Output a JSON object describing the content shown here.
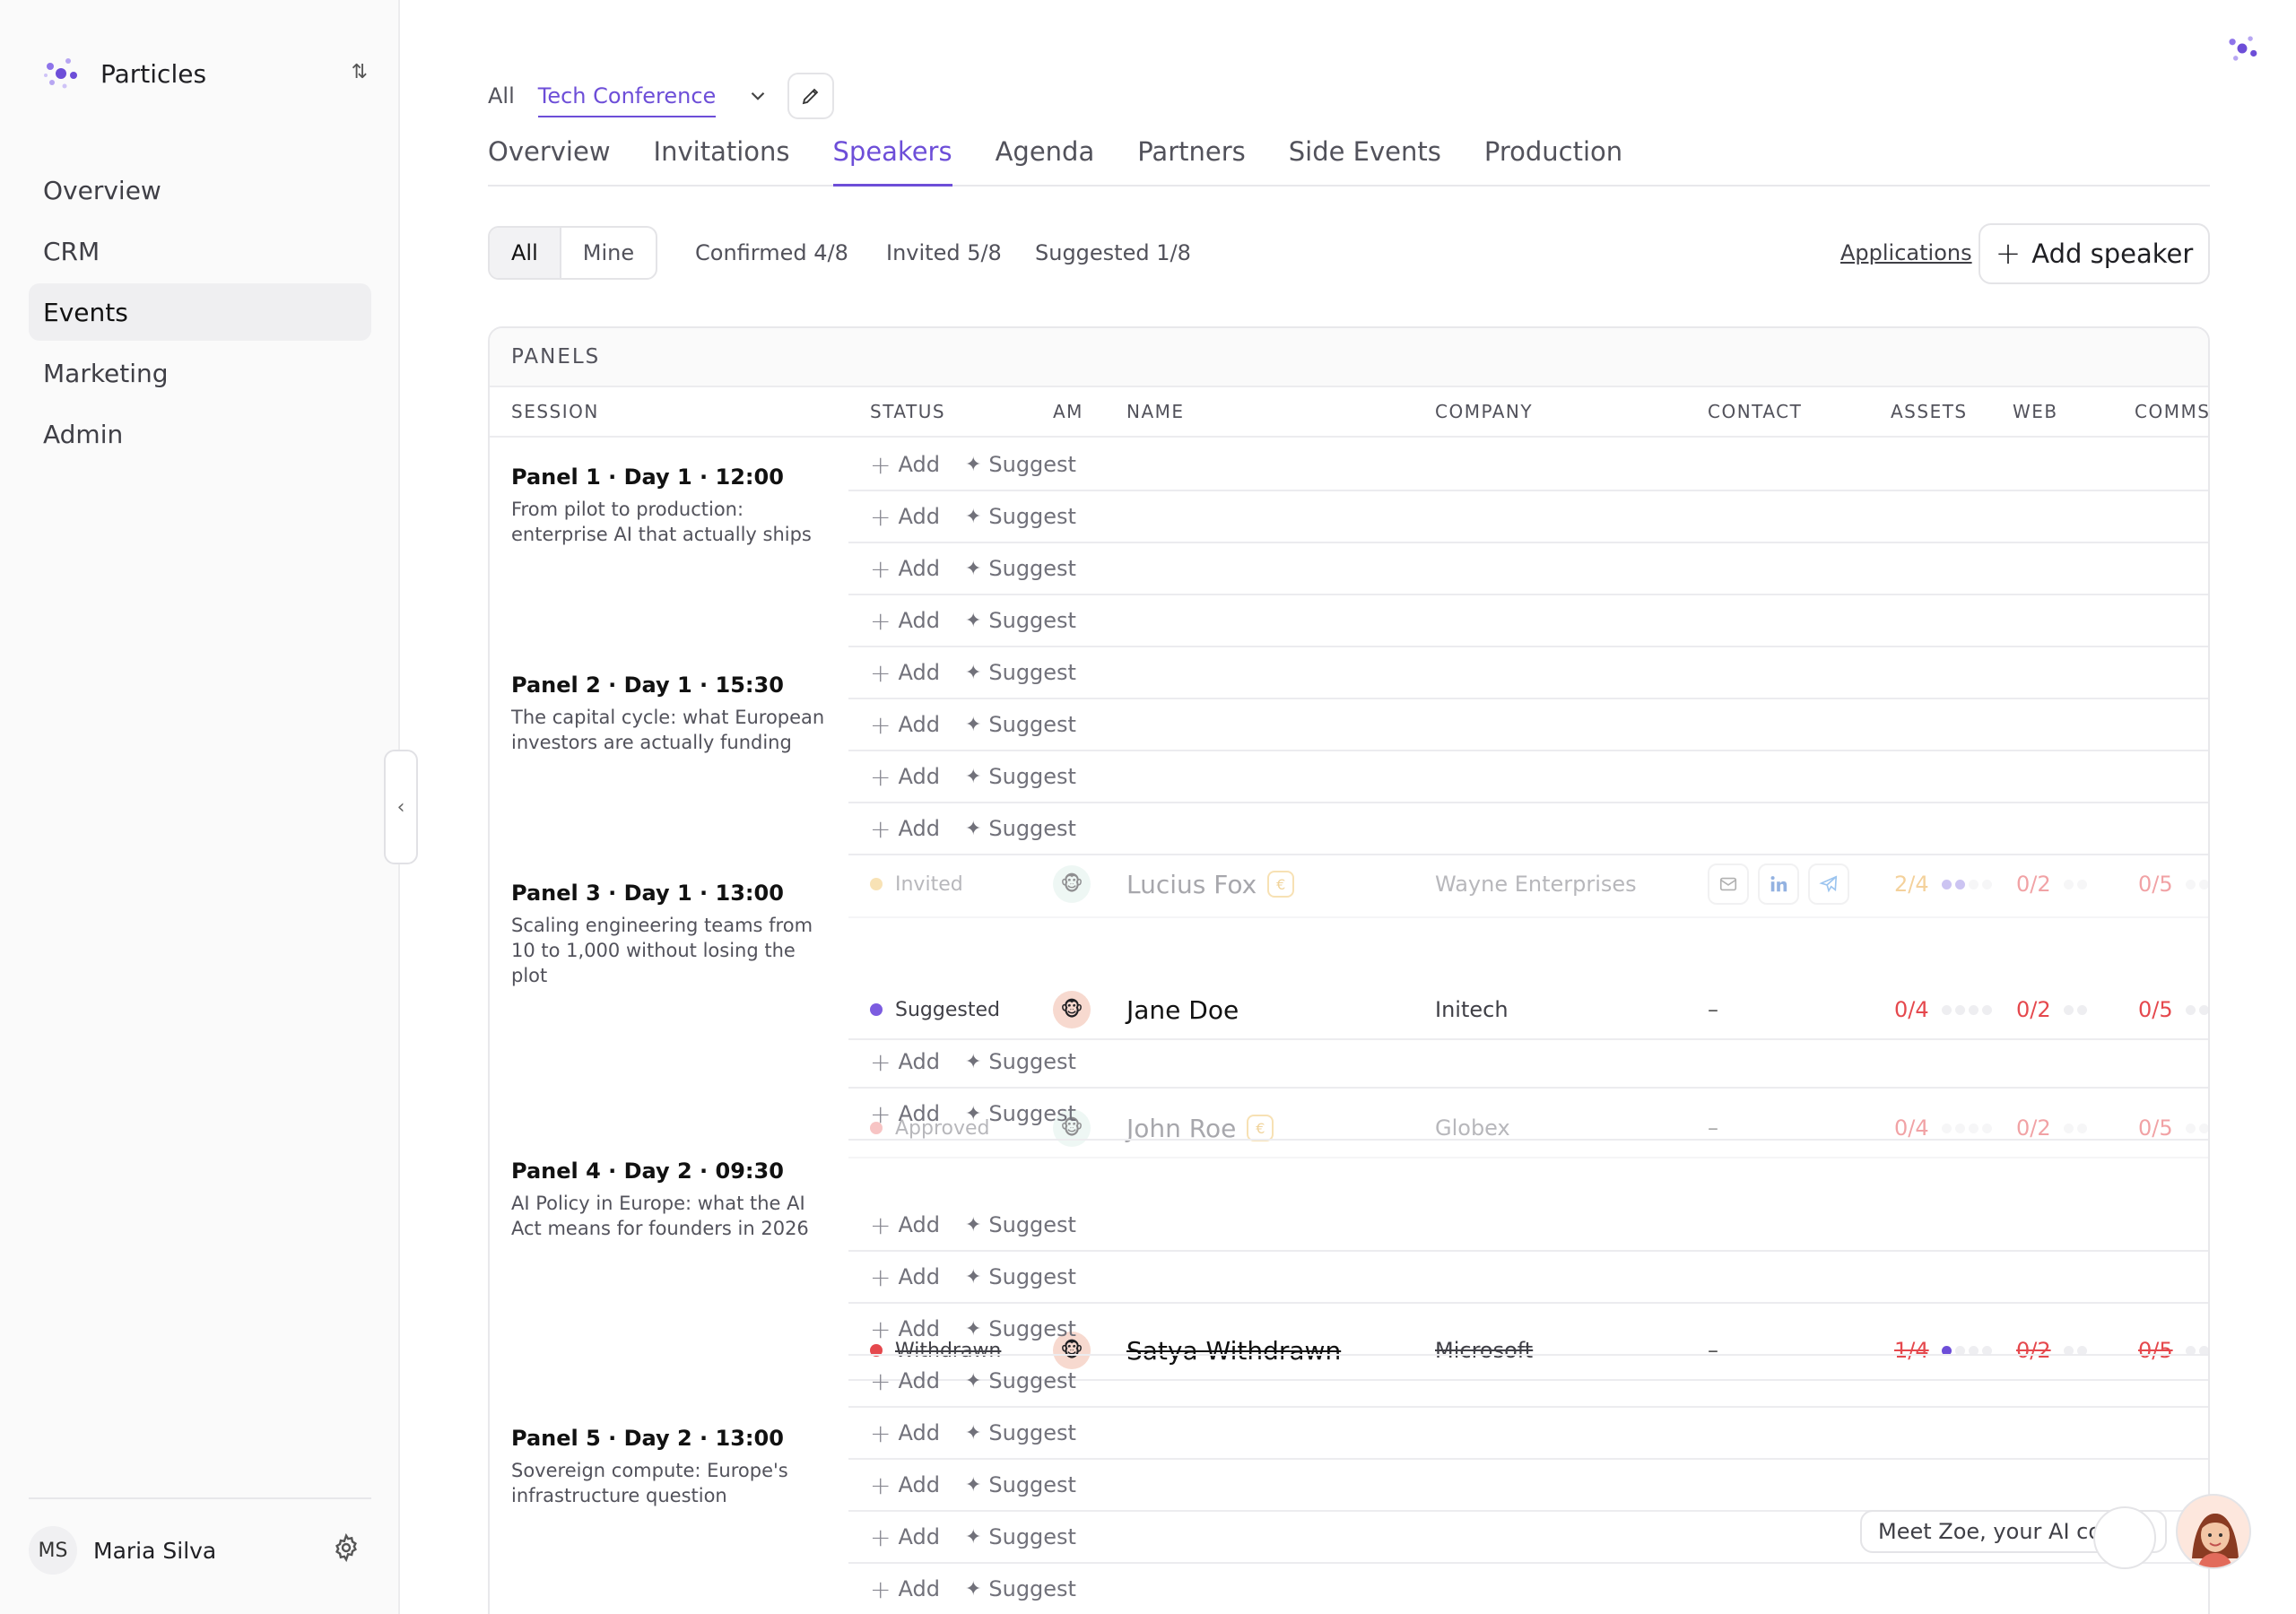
{
  "sidebar": {
    "brand": "Particles",
    "switch_icon": "⇅",
    "items": [
      {
        "label": "Overview"
      },
      {
        "label": "CRM"
      },
      {
        "label": "Events"
      },
      {
        "label": "Marketing"
      },
      {
        "label": "Admin"
      }
    ],
    "user": {
      "initials": "MS",
      "name": "Maria Silva"
    },
    "collapse_glyph": "‹"
  },
  "header": {
    "crumb_all": "All",
    "crumb_active": "Tech Conference",
    "tabs": [
      "Overview",
      "Invitations",
      "Speakers",
      "Agenda",
      "Partners",
      "Side Events",
      "Production"
    ]
  },
  "filters": {
    "seg_all": "All",
    "seg_mine": "Mine",
    "confirmed": "Confirmed 4/8",
    "invited": "Invited 5/8",
    "suggested": "Suggested 1/8",
    "applications": "Applications",
    "add_speaker": "Add speaker",
    "add_glyph": "+"
  },
  "table": {
    "section": "PANELS",
    "columns": [
      "SESSION",
      "STATUS",
      "AM",
      "NAME",
      "COMPANY",
      "CONTACT",
      "ASSETS",
      "WEB",
      "COMMS"
    ],
    "add_label": "Add",
    "suggest_label": "Suggest",
    "plus_glyph": "+",
    "sparkle_glyph": "✦",
    "euro_glyph": "€",
    "dash": "–",
    "sessions": [
      {
        "title": "Panel 1 · Day 1 · 12:00",
        "desc": "From pilot to production: enterprise AI that actually ships"
      },
      {
        "title": "Panel 2 · Day 1 · 15:30",
        "desc": "The capital cycle: what European investors are actually funding"
      },
      {
        "title": "Panel 3 · Day 1 · 13:00",
        "desc": "Scaling engineering teams from 10 to 1,000 without losing the plot"
      },
      {
        "title": "Panel 4 · Day 2 · 09:30",
        "desc": "AI Policy in Europe: what the AI Act means for founders in 2026"
      },
      {
        "title": "Panel 5 · Day 2 · 13:00",
        "desc": "Sovereign compute: Europe's infrastructure question"
      }
    ],
    "speakers": [
      {
        "status": "Invited",
        "status_color": "#f2c66d",
        "name": "Lucius Fox",
        "euro": true,
        "company": "Wayne Enterprises",
        "contact": "icons",
        "assets": "2/4",
        "assets_filled": 2,
        "assets_color": "#eaa43a",
        "web": "0/2",
        "comms": "0/5",
        "faded": true,
        "am_emoji": "🐵",
        "am_bg": "#dff0ea"
      },
      {
        "status": "Suggested",
        "status_color": "#7c5ce0",
        "name": "Jane Doe",
        "euro": false,
        "company": "Initech",
        "contact": "–",
        "assets": "0/4",
        "assets_filled": 0,
        "assets_color": "#e5484d",
        "web": "0/2",
        "comms": "0/5",
        "faded": false,
        "am_emoji": "🐵",
        "am_bg": "#f7d9cf"
      },
      {
        "status": "Approved",
        "status_color": "#f08b8b",
        "name": "John Roe",
        "euro": true,
        "company": "Globex",
        "contact": "–",
        "assets": "0/4",
        "assets_filled": 0,
        "assets_color": "#e5484d",
        "web": "0/2",
        "comms": "0/5",
        "faded": true,
        "am_emoji": "🐵",
        "am_bg": "#dff0ea"
      },
      {
        "status": "Withdrawn",
        "status_color": "#e5484d",
        "name": "Satya Withdrawn",
        "euro": false,
        "company": "Microsoft",
        "contact": "–",
        "assets": "1/4",
        "assets_filled": 1,
        "assets_color": "#e5484d",
        "web": "0/2",
        "comms": "0/5",
        "faded": false,
        "struck": true,
        "am_emoji": "🐵",
        "am_bg": "#f7d9cf"
      }
    ]
  },
  "copilot": {
    "label": "Meet Zoe, your AI copilot"
  },
  "colors": {
    "accent": "#6d4ed8",
    "danger": "#e5484d",
    "warning": "#eaa43a"
  }
}
